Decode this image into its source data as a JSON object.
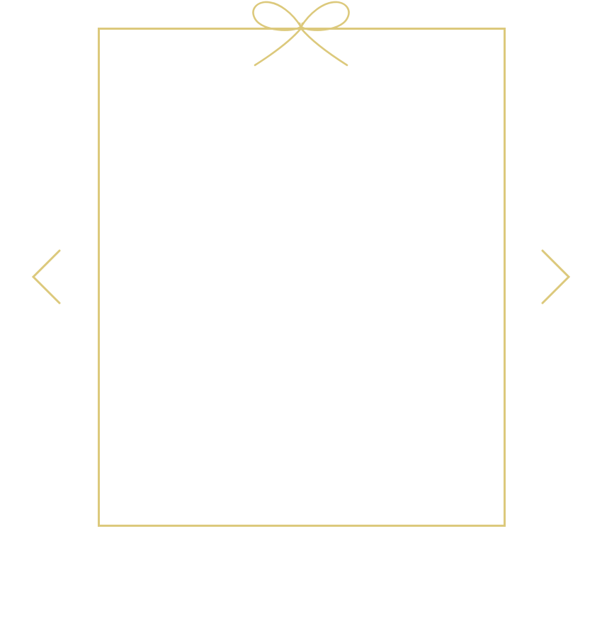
{
  "theme": {
    "accent": "#dcc97c",
    "background": "#ffffff"
  },
  "carousel": {
    "frame": {
      "icon": "gift-bow-icon"
    },
    "prev": {
      "icon": "chevron-left-icon"
    },
    "next": {
      "icon": "chevron-right-icon"
    }
  }
}
